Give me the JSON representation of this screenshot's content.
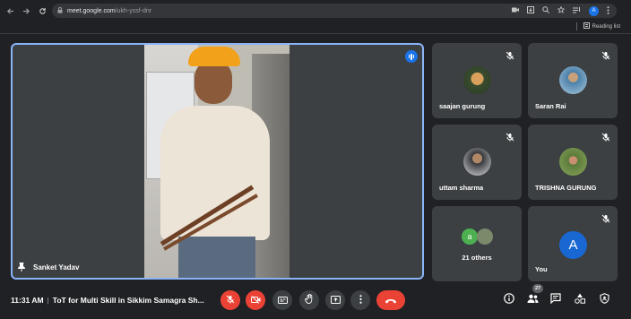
{
  "browser": {
    "url_host": "meet.google.com",
    "url_path": "/ukh-yssf-dnr",
    "profile_initial": "A",
    "reading_list_label": "Reading list"
  },
  "main_tile": {
    "participant_name": "Sanket Yadav"
  },
  "participants": [
    {
      "name": "saajan gurung"
    },
    {
      "name": "Saran Rai"
    },
    {
      "name": "uttam sharma"
    },
    {
      "name": "TRISHNA GURUNG"
    },
    {
      "name": "21 others",
      "avatar_initial": "a"
    },
    {
      "name": "You",
      "avatar_initial": "A"
    }
  ],
  "bottom_bar": {
    "time": "11:31 AM",
    "meeting_title": "ToT for Multi Skill in Sikkim Samagra Sh...",
    "participant_count": "27"
  },
  "colors": {
    "background": "#202124",
    "tile": "#3c4043",
    "active_border": "#8ab4f8",
    "danger": "#ea4335",
    "accent": "#1a73e8"
  }
}
